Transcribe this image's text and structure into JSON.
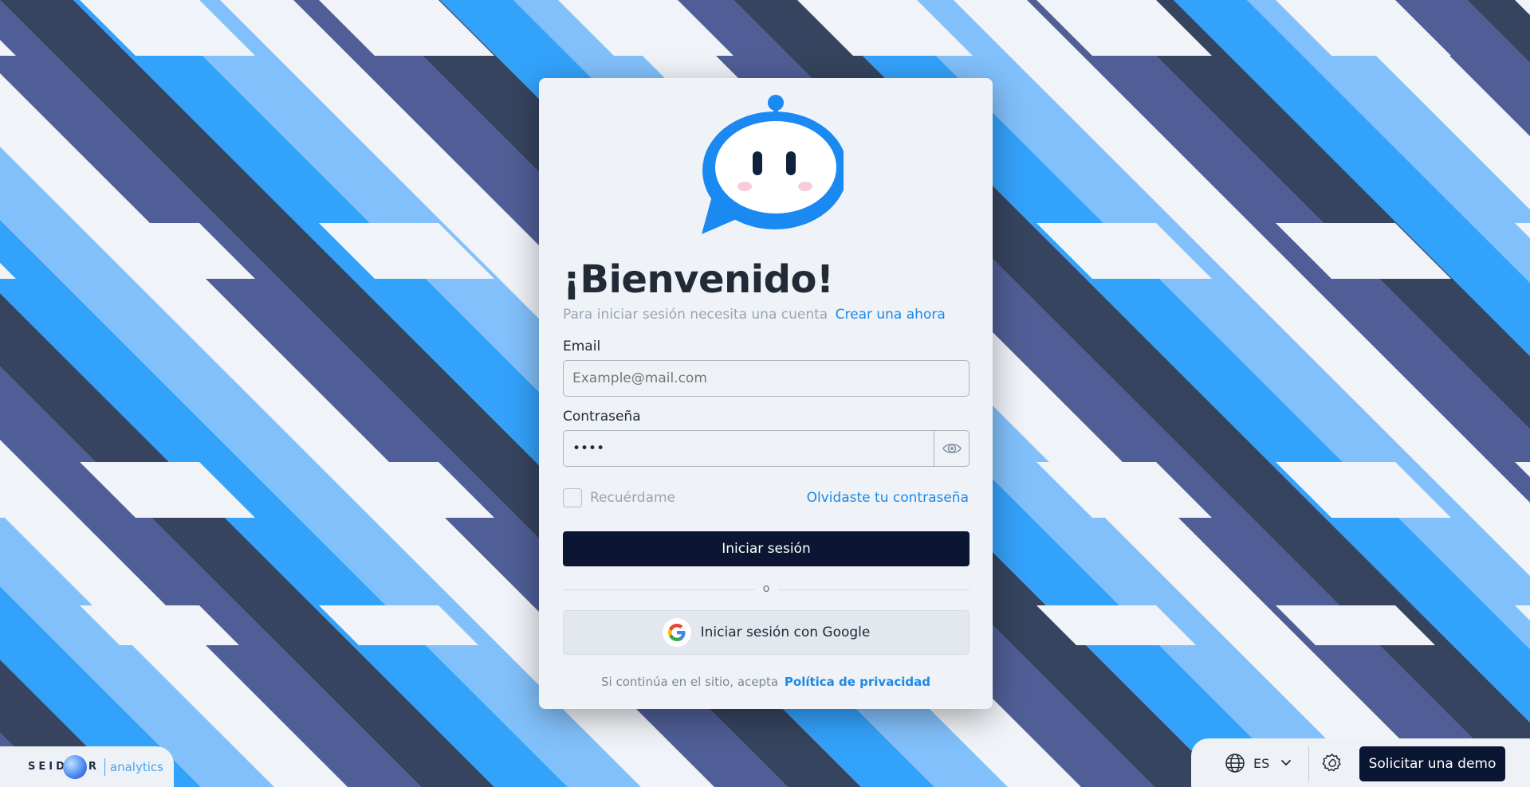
{
  "login": {
    "title": "¡Bienvenido!",
    "subtitle": "Para iniciar sesión necesita una cuenta",
    "create_account_link": "Crear una ahora",
    "email_label": "Email",
    "email_placeholder": "Example@mail.com",
    "email_value": "",
    "password_label": "Contraseña",
    "password_value": "****",
    "remember_label": "Recuérdame",
    "remember_checked": false,
    "forgot_link": "Olvidaste tu contraseña",
    "login_button": "Iniciar sesión",
    "divider_text": "o",
    "google_button": "Iniciar sesión con Google",
    "terms_text": "Si continúa en el sitio, acepta",
    "privacy_link": "Política de privacidad"
  },
  "brand": {
    "seidor_pre": "SEID",
    "seidor_post": "R",
    "analytics": "analytics"
  },
  "footer": {
    "language_code": "ES",
    "demo_button": "Solicitar una demo"
  },
  "colors": {
    "navy_button": "#0b1633",
    "link_blue": "#1e88e5",
    "mascot_blue": "#1a8af2",
    "bg_dark": "#36445f",
    "bg_blue": "#33a2fb",
    "bg_light_blue": "#82c0fb",
    "bg_white": "#f0f3f8",
    "bg_violet": "#4f5e96"
  },
  "icons": {
    "mascot": "robot-chat-mascot-icon",
    "eye": "eye-icon",
    "google": "google-g-icon",
    "globe": "globe-icon",
    "chevron": "chevron-down-icon",
    "gear": "gear-icon"
  }
}
